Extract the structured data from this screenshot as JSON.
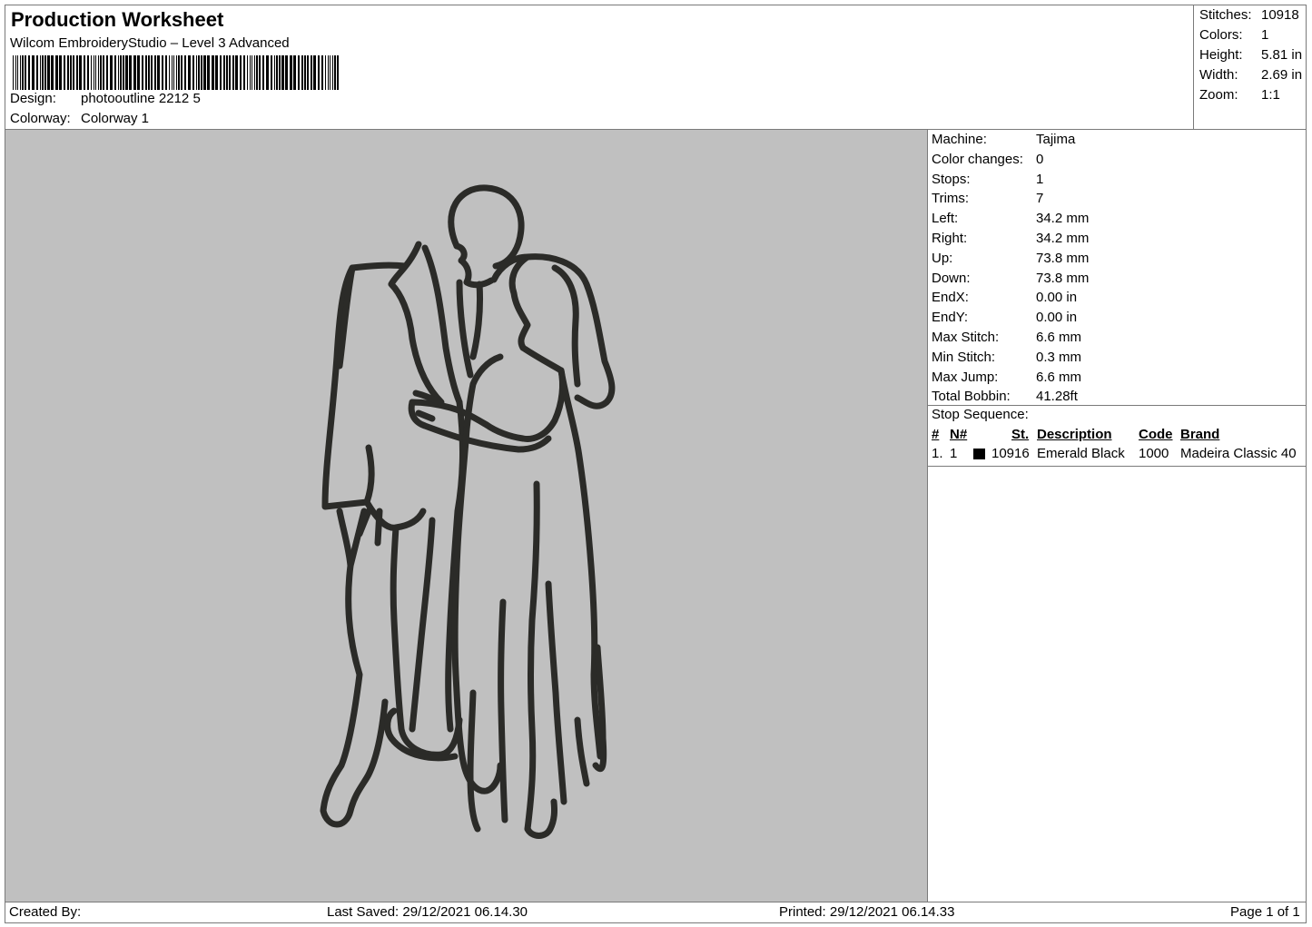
{
  "header": {
    "title": "Production Worksheet",
    "subtitle": "Wilcom EmbroideryStudio – Level 3 Advanced",
    "design_label": "Design:",
    "design_value": "photooutline 2212 5",
    "colorway_label": "Colorway:",
    "colorway_value": "Colorway 1"
  },
  "summary": {
    "rows": [
      {
        "label": "Stitches:",
        "value": "10918"
      },
      {
        "label": "Colors:",
        "value": "1"
      },
      {
        "label": "Height:",
        "value": "5.81 in"
      },
      {
        "label": "Width:",
        "value": "2.69 in"
      },
      {
        "label": "Zoom:",
        "value": "1:1"
      }
    ]
  },
  "details": {
    "rows": [
      {
        "label": "Machine:",
        "value": "Tajima"
      },
      {
        "label": "Color changes:",
        "value": "0"
      },
      {
        "label": "Stops:",
        "value": "1"
      },
      {
        "label": "Trims:",
        "value": "7"
      },
      {
        "label": "Left:",
        "value": "34.2 mm"
      },
      {
        "label": "Right:",
        "value": "34.2 mm"
      },
      {
        "label": "Up:",
        "value": "73.8 mm"
      },
      {
        "label": "Down:",
        "value": "73.8 mm"
      },
      {
        "label": "EndX:",
        "value": "0.00 in"
      },
      {
        "label": "EndY:",
        "value": "0.00 in"
      },
      {
        "label": "Max Stitch:",
        "value": "6.6 mm"
      },
      {
        "label": "Min Stitch:",
        "value": "0.3 mm"
      },
      {
        "label": "Max Jump:",
        "value": "6.6 mm"
      },
      {
        "label": "Total Bobbin:",
        "value": "41.28ft"
      }
    ]
  },
  "stop_sequence": {
    "title": "Stop Sequence:",
    "headers": {
      "num": "#",
      "n": "N#",
      "st": "St.",
      "description": "Description",
      "code": "Code",
      "brand": "Brand"
    },
    "rows": [
      {
        "num": "1.",
        "n": "1",
        "swatch_color": "#000000",
        "st": "10916",
        "description": "Emerald Black",
        "code": "1000",
        "brand": "Madeira Classic 40"
      }
    ]
  },
  "footer": {
    "created_by": "Created By:",
    "last_saved": "Last Saved: 29/12/2021 06.14.30",
    "printed": "Printed: 29/12/2021 06.14.33",
    "page": "Page 1 of 1"
  },
  "colors": {
    "preview_background": "#c0c0c0",
    "stitch_color": "#2b2b28",
    "border": "#7a7a7a"
  }
}
